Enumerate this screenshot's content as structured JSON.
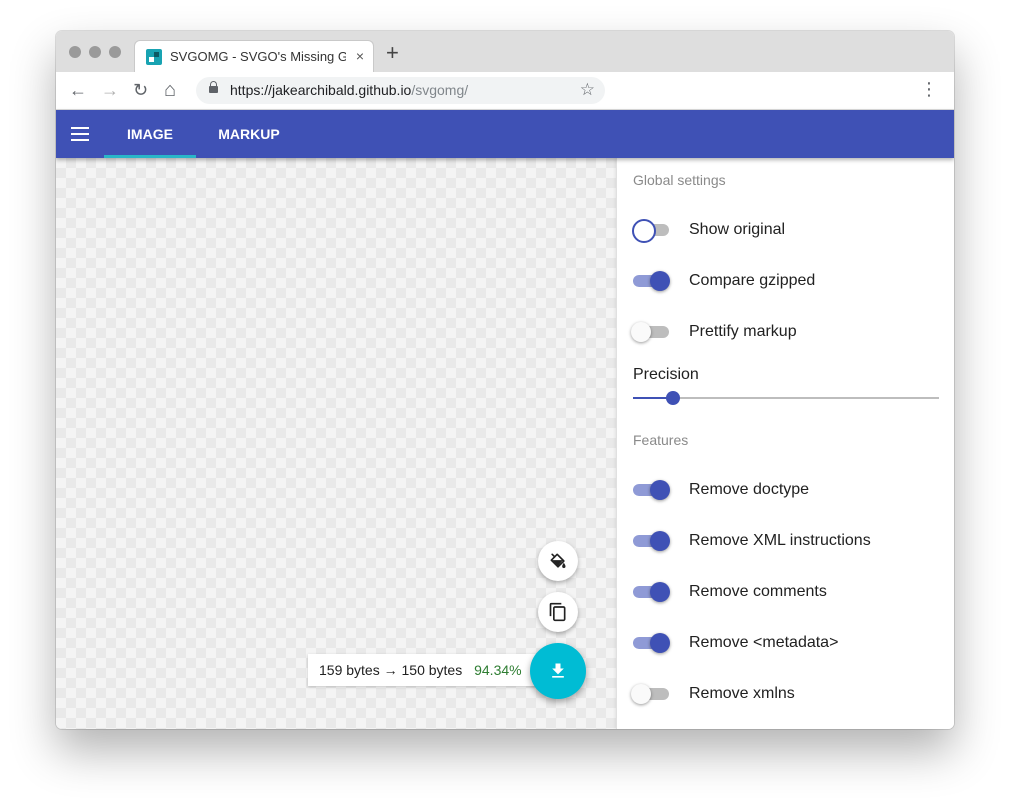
{
  "browser": {
    "tab_title": "SVGOMG - SVGO's Missing GUI",
    "tab_close_glyph": "×",
    "new_tab_glyph": "+",
    "url_host": "https://jakearchibald.github.io",
    "url_path": "/svgomg/",
    "back_glyph": "←",
    "forward_glyph": "→",
    "reload_glyph": "↻",
    "home_glyph": "⌂",
    "star_glyph": "☆",
    "menu_glyph": "⋮"
  },
  "appbar": {
    "tabs": [
      {
        "label": "IMAGE",
        "active": true
      },
      {
        "label": "MARKUP",
        "active": false
      }
    ]
  },
  "settings": {
    "global_title": "Global settings",
    "global": [
      {
        "label": "Show original",
        "state": "off-focused"
      },
      {
        "label": "Compare gzipped",
        "state": "on"
      },
      {
        "label": "Prettify markup",
        "state": "off"
      }
    ],
    "precision_label": "Precision",
    "precision_fraction": 0.13,
    "features_title": "Features",
    "features": [
      {
        "label": "Remove doctype",
        "state": "on"
      },
      {
        "label": "Remove XML instructions",
        "state": "on"
      },
      {
        "label": "Remove comments",
        "state": "on"
      },
      {
        "label": "Remove <metadata>",
        "state": "on"
      },
      {
        "label": "Remove xmlns",
        "state": "off"
      }
    ]
  },
  "results": {
    "original": "159 bytes",
    "arrow": "→",
    "optimized": "150 bytes",
    "percent": "94.34%"
  },
  "colors": {
    "primary": "#3f51b5",
    "accent": "#00bcd4",
    "percent_green": "#2e7d32"
  },
  "icons": [
    "paint-bucket-icon",
    "copy-icon",
    "download-icon"
  ]
}
